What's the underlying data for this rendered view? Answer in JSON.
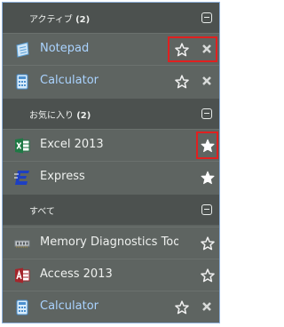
{
  "sections": [
    {
      "label": "アクティブ",
      "count": "(2)"
    },
    {
      "label": "お気に入り",
      "count": "(2)"
    },
    {
      "label": "すべて",
      "count": ""
    }
  ],
  "active_items": [
    {
      "label": "Notepad",
      "icon": "notepad-icon"
    },
    {
      "label": "Calculator",
      "icon": "calculator-icon"
    }
  ],
  "favorite_items": [
    {
      "label": "Excel 2013",
      "icon": "excel-icon"
    },
    {
      "label": "Express",
      "icon": "express-icon"
    }
  ],
  "all_items": [
    {
      "label": "Memory Diagnostics Tool",
      "icon": "memory-diagnostics-icon"
    },
    {
      "label": "Access 2013",
      "icon": "access-icon"
    },
    {
      "label": "Calculator",
      "icon": "calculator-icon"
    }
  ],
  "colors": {
    "link_blue": "#aad3ff",
    "highlight_red": "#e02020",
    "panel_bg": "#5e6461",
    "header_bg": "#4c514f"
  }
}
